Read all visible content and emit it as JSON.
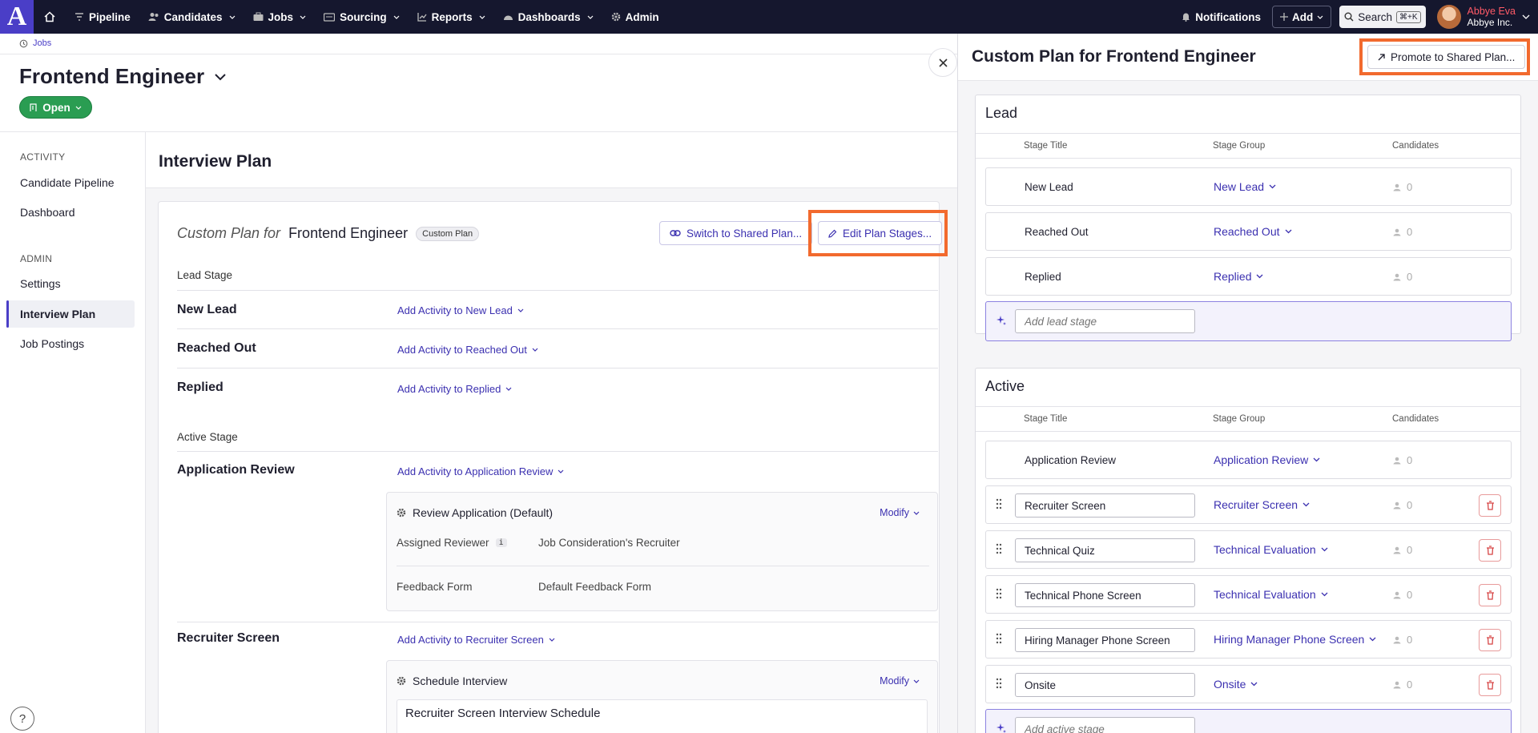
{
  "nav": {
    "logo": "A",
    "items": [
      {
        "label": "Pipeline",
        "icon": "filter-icon",
        "chevron": false
      },
      {
        "label": "Candidates",
        "icon": "people-icon",
        "chevron": true
      },
      {
        "label": "Jobs",
        "icon": "briefcase-icon",
        "chevron": true
      },
      {
        "label": "Sourcing",
        "icon": "sourcing-icon",
        "chevron": true
      },
      {
        "label": "Reports",
        "icon": "chart-icon",
        "chevron": true
      },
      {
        "label": "Dashboards",
        "icon": "dashboard-icon",
        "chevron": true
      },
      {
        "label": "Admin",
        "icon": "gear-icon",
        "chevron": false
      }
    ],
    "notifications": "Notifications",
    "add": "Add",
    "search": "Search",
    "search_shortcut": "⌘+K",
    "user_name": "Abbye Eva",
    "user_org": "Abbye Inc."
  },
  "breadcrumb": "Jobs",
  "job": {
    "title": "Frontend Engineer",
    "status": "Open"
  },
  "sidebar": {
    "activity_heading": "ACTIVITY",
    "activity_items": [
      "Candidate Pipeline",
      "Dashboard"
    ],
    "admin_heading": "ADMIN",
    "admin_items": [
      "Settings",
      "Interview Plan",
      "Job Postings"
    ],
    "active_item": "Interview Plan",
    "help": "?"
  },
  "main": {
    "heading": "Interview Plan",
    "plan_title_prefix": "Custom Plan for",
    "plan_title_job": "Frontend Engineer",
    "plan_badge": "Custom Plan",
    "switch_button": "Switch to Shared Plan...",
    "edit_button": "Edit Plan Stages...",
    "lead_stage_label": "Lead Stage",
    "active_stage_label": "Active Stage",
    "lead_stages": [
      {
        "name": "New Lead",
        "action": "Add Activity to New Lead"
      },
      {
        "name": "Reached Out",
        "action": "Add Activity to Reached Out"
      },
      {
        "name": "Replied",
        "action": "Add Activity to Replied"
      }
    ],
    "active_stages": [
      {
        "name": "Application Review",
        "action": "Add Activity to Application Review"
      },
      {
        "name": "Recruiter Screen",
        "action": "Add Activity to Recruiter Screen"
      }
    ],
    "review_activity": {
      "title": "Review Application (Default)",
      "modify": "Modify",
      "reviewer_label": "Assigned Reviewer",
      "reviewer_info": "i",
      "reviewer_value": "Job Consideration's Recruiter",
      "form_label": "Feedback Form",
      "form_value": "Default Feedback Form"
    },
    "schedule_activity": {
      "title": "Schedule Interview",
      "modify": "Modify",
      "schedule_title": "Recruiter Screen Interview Schedule"
    }
  },
  "panel": {
    "title": "Custom Plan for Frontend Engineer",
    "promote_button": "Promote to Shared Plan...",
    "col_stage_title": "Stage Title",
    "col_stage_group": "Stage Group",
    "col_candidates": "Candidates",
    "lead": {
      "title": "Lead",
      "rows": [
        {
          "title": "New Lead",
          "group": "New Lead",
          "count": "0"
        },
        {
          "title": "Reached Out",
          "group": "Reached Out",
          "count": "0"
        },
        {
          "title": "Replied",
          "group": "Replied",
          "count": "0"
        }
      ],
      "add_placeholder": "Add lead stage"
    },
    "active": {
      "title": "Active",
      "fixed_row": {
        "title": "Application Review",
        "group": "Application Review",
        "count": "0"
      },
      "rows": [
        {
          "title": "Recruiter Screen",
          "group": "Recruiter Screen",
          "count": "0"
        },
        {
          "title": "Technical Quiz",
          "group": "Technical Evaluation",
          "count": "0"
        },
        {
          "title": "Technical Phone Screen",
          "group": "Technical Evaluation",
          "count": "0"
        },
        {
          "title": "Hiring Manager Phone Screen",
          "group": "Hiring Manager Phone Screen",
          "count": "0"
        },
        {
          "title": "Onsite",
          "group": "Onsite",
          "count": "0"
        }
      ],
      "add_placeholder": "Add active stage"
    }
  },
  "colors": {
    "accent": "#4a3ec7",
    "nav_bg": "#15172e",
    "status_green": "#2a9d52",
    "highlight": "#f26a2e",
    "danger": "#d64545"
  }
}
